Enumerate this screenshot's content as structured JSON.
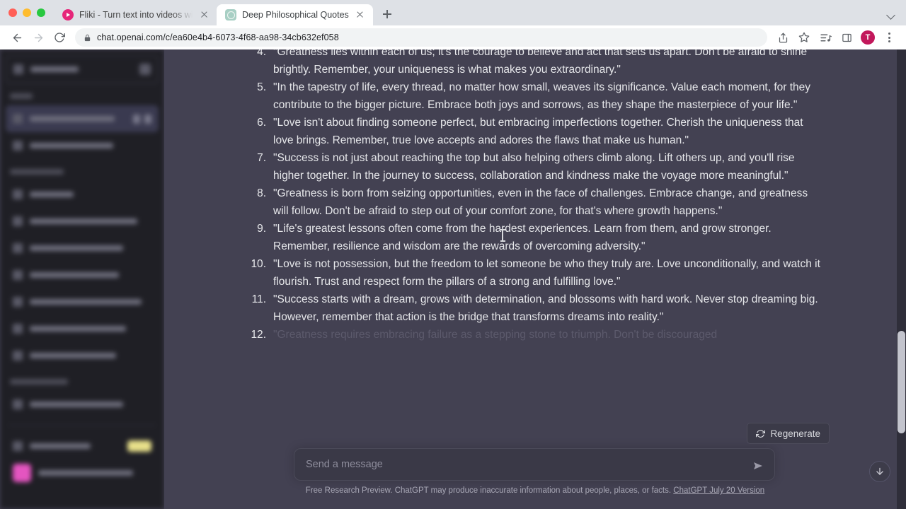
{
  "browser": {
    "window_controls": [
      "close",
      "minimize",
      "maximize"
    ],
    "tabs": [
      {
        "title": "Fliki - Turn text into videos wit",
        "favicon": "fliki-play-icon",
        "active": false
      },
      {
        "title": "Deep Philosophical Quotes",
        "favicon": "chatgpt-icon",
        "active": true
      }
    ],
    "new_tab_label": "+",
    "toolbar": {
      "back_label": "Back",
      "forward_label": "Forward",
      "reload_label": "Reload",
      "url": "chat.openai.com/c/ea60e4b4-6073-4f68-aa98-34cb632ef058",
      "url_domain": "chat.openai.com",
      "url_path": "/c/ea60e4b4-6073-4f68-aa98-34cb632ef058",
      "share_label": "Share",
      "bookmark_label": "Bookmark this tab",
      "reading_list_label": "Reading list",
      "side_panel_label": "Side panel",
      "profile_initial": "T",
      "menu_label": "Customize and control Google Chrome"
    }
  },
  "sidebar": {
    "blurred": true,
    "new_chat_label": "New chat",
    "upgrade_badge_color": "#e8e08a",
    "avatar_color": "#e455c0"
  },
  "conversation": {
    "items": [
      {
        "number": "4.",
        "text": "\"Greatness lies within each of us; it's the courage to believe and act that sets us apart. Don't be afraid to shine brightly. Remember, your uniqueness is what makes you extraordinary.\"",
        "clipped": true,
        "faded": false
      },
      {
        "number": "5.",
        "text": "\"In the tapestry of life, every thread, no matter how small, weaves its significance. Value each moment, for they contribute to the bigger picture. Embrace both joys and sorrows, as they shape the masterpiece of your life.\"",
        "clipped": false,
        "faded": false
      },
      {
        "number": "6.",
        "text": "\"Love isn't about finding someone perfect, but embracing imperfections together. Cherish the uniqueness that love brings. Remember, true love accepts and adores the flaws that make us human.\"",
        "clipped": false,
        "faded": false
      },
      {
        "number": "7.",
        "text": "\"Success is not just about reaching the top but also helping others climb along. Lift others up, and you'll rise higher together. In the journey to success, collaboration and kindness make the voyage more meaningful.\"",
        "clipped": false,
        "faded": false
      },
      {
        "number": "8.",
        "text": "\"Greatness is born from seizing opportunities, even in the face of challenges. Embrace change, and greatness will follow. Don't be afraid to step out of your comfort zone, for that's where growth happens.\"",
        "clipped": false,
        "faded": false
      },
      {
        "number": "9.",
        "text": "\"Life's greatest lessons often come from the hardest experiences. Learn from them, and grow stronger. Remember, resilience and wisdom are the rewards of overcoming adversity.\"",
        "clipped": false,
        "faded": false
      },
      {
        "number": "10.",
        "text": "\"Love is not possession, but the freedom to let someone be who they truly are. Love unconditionally, and watch it flourish. Trust and respect form the pillars of a strong and fulfilling love.\"",
        "clipped": false,
        "faded": false
      },
      {
        "number": "11.",
        "text": "\"Success starts with a dream, grows with determination, and blossoms with hard work. Never stop dreaming big. However, remember that action is the bridge that transforms dreams into reality.\"",
        "clipped": false,
        "faded": false
      },
      {
        "number": "12.",
        "text": "\"Greatness requires embracing failure as a stepping stone to triumph. Don't be discouraged",
        "clipped": false,
        "faded": true
      }
    ]
  },
  "actions": {
    "regenerate_label": "Regenerate",
    "regenerate_icon": "refresh-icon",
    "scroll_to_bottom_icon": "arrow-down-icon"
  },
  "composer": {
    "placeholder": "Send a message",
    "value": "",
    "send_icon": "send-arrow-icon"
  },
  "footer": {
    "disclaimer": "Free Research Preview. ChatGPT may produce inaccurate information about people, places, or facts.",
    "version_link": "ChatGPT July 20 Version"
  },
  "theme": {
    "page_background": "#434152",
    "sidebar_background": "#1f1f25",
    "composer_background": "#3a3947",
    "text_color": "#e6e7ea",
    "accent_avatar": "#c2185b"
  }
}
